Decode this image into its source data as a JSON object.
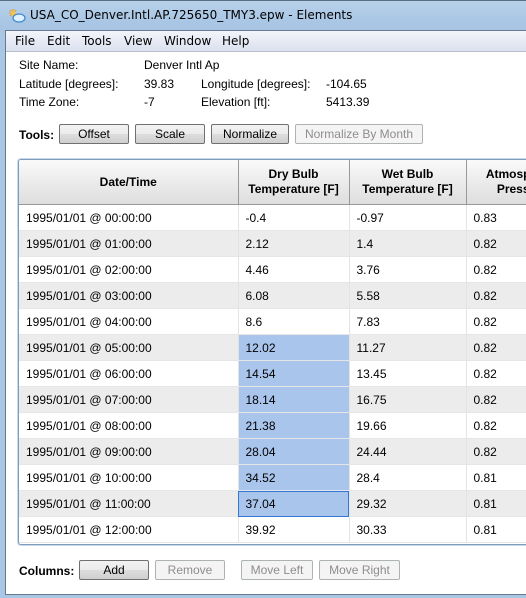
{
  "window": {
    "title": "USA_CO_Denver.Intl.AP.725650_TMY3.epw - Elements",
    "icon": "sun-cloud-icon"
  },
  "menu": [
    "File",
    "Edit",
    "Tools",
    "View",
    "Window",
    "Help"
  ],
  "site": {
    "site_name_label": "Site Name:",
    "site_name": "Denver Intl Ap",
    "latitude_label": "Latitude [degrees]:",
    "latitude": "39.83",
    "longitude_label": "Longitude [degrees]:",
    "longitude": "-104.65",
    "timezone_label": "Time Zone:",
    "timezone": "-7",
    "elevation_label": "Elevation [ft]:",
    "elevation": "5413.39"
  },
  "tools": {
    "label": "Tools:",
    "offset": "Offset",
    "scale": "Scale",
    "normalize": "Normalize",
    "normalize_by_month": "Normalize By Month"
  },
  "table": {
    "columns": [
      {
        "line1": "Date/Time",
        "line2": ""
      },
      {
        "line1": "Dry Bulb",
        "line2": "Temperature [F]"
      },
      {
        "line1": "Wet Bulb",
        "line2": "Temperature [F]"
      },
      {
        "line1": "Atmospheric",
        "line2": "Pressure"
      }
    ],
    "rows": [
      [
        "1995/01/01 @ 00:00:00",
        "-0.4",
        "-0.97",
        "0.83"
      ],
      [
        "1995/01/01 @ 01:00:00",
        "2.12",
        "1.4",
        "0.82"
      ],
      [
        "1995/01/01 @ 02:00:00",
        "4.46",
        "3.76",
        "0.82"
      ],
      [
        "1995/01/01 @ 03:00:00",
        "6.08",
        "5.58",
        "0.82"
      ],
      [
        "1995/01/01 @ 04:00:00",
        "8.6",
        "7.83",
        "0.82"
      ],
      [
        "1995/01/01 @ 05:00:00",
        "12.02",
        "11.27",
        "0.82"
      ],
      [
        "1995/01/01 @ 06:00:00",
        "14.54",
        "13.45",
        "0.82"
      ],
      [
        "1995/01/01 @ 07:00:00",
        "18.14",
        "16.75",
        "0.82"
      ],
      [
        "1995/01/01 @ 08:00:00",
        "21.38",
        "19.66",
        "0.82"
      ],
      [
        "1995/01/01 @ 09:00:00",
        "28.04",
        "24.44",
        "0.82"
      ],
      [
        "1995/01/01 @ 10:00:00",
        "34.52",
        "28.4",
        "0.81"
      ],
      [
        "1995/01/01 @ 11:00:00",
        "37.04",
        "29.32",
        "0.81"
      ],
      [
        "1995/01/01 @ 12:00:00",
        "39.92",
        "30.33",
        "0.81"
      ]
    ],
    "selected_column": 1,
    "selected_rows": [
      5,
      6,
      7,
      8,
      9,
      10,
      11
    ],
    "focused_row": 11,
    "selection_color": "#aac5ec"
  },
  "columns_bar": {
    "label": "Columns:",
    "add": "Add",
    "remove": "Remove",
    "move_left": "Move Left",
    "move_right": "Move Right"
  }
}
